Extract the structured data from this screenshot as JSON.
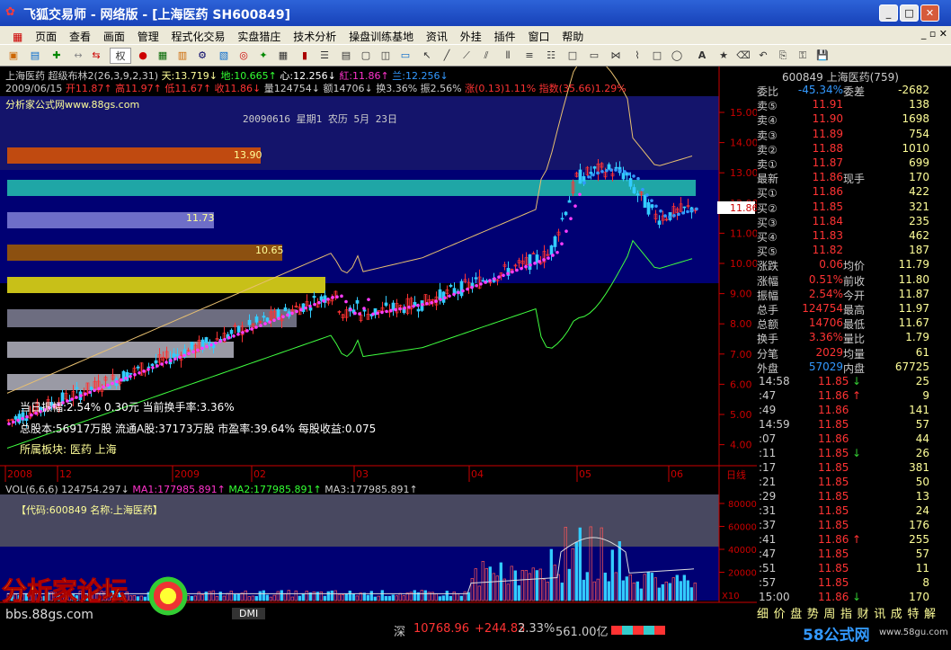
{
  "title": "飞狐交易师 - 网络版 - [上海医药 SH600849]",
  "menu": [
    "页面",
    "查看",
    "画面",
    "管理",
    "程式化交易",
    "实盘猎庄",
    "技术分析",
    "操盘训练基地",
    "资讯",
    "外挂",
    "插件",
    "窗口",
    "帮助"
  ],
  "toolbar": {
    "rights": "权"
  },
  "header": {
    "line1_name": "上海医药",
    "line1_ind": "超级布林2(26,3,9,2,31)",
    "tian": "天:13.719↓",
    "di": "地:10.665↑",
    "xin": "心:12.256↓",
    "hong": "紅:11.86↑",
    "lan": "兰:12.256↓",
    "date": "2009/06/15",
    "open": "开11.87↑",
    "high": "高11.97↑",
    "low": "低11.67↑",
    "close": "收11.86↓",
    "vol": "量124754↓",
    "amt": "额14706↓",
    "turn": "换3.36%",
    "amp": "振2.56%",
    "chg": "涨(0.13)1.11%",
    "idx": "指数(35.66)1.29%"
  },
  "chart": {
    "site": "分析家公式网www.88gs.com",
    "date_note": "20090616 星期1 农历 5月 23日",
    "zone_labels": [
      "13.90",
      "11.73",
      "10.65"
    ],
    "price_ticks": [
      "15.00",
      "14.00",
      "13.00",
      "12.00",
      "11.00",
      "10.00",
      "9.00",
      "8.00",
      "7.00",
      "6.00",
      "5.00",
      "4.00"
    ],
    "time_ticks": [
      "2008",
      "12",
      "2009",
      "02",
      "03",
      "04",
      "05",
      "06"
    ],
    "day_label": "日线",
    "cur_price": "11.86",
    "info1": "当日振幅:2.54%   0.30元    当前换手率:3.36%",
    "info2": "总股本:56917万股 流通A股:37173万股 市盈率:39.64%  每股收益:0.075",
    "info3": "所属板块: 医药 上海"
  },
  "vol": {
    "header": "VOL(6,6,6) 124754.297↓",
    "ma1": "MA1:177985.891↑",
    "ma2": "MA2:177985.891↑",
    "ma3": "MA3:177985.891↑",
    "code_label": "【代码:600849 名称:上海医药】",
    "ticks": [
      "80000",
      "60000",
      "40000",
      "20000"
    ],
    "unit": "X10",
    "tab": "DMI"
  },
  "quote": {
    "title": "600849 上海医药(759)",
    "rows": [
      {
        "l": "委比",
        "v": "-45.34%",
        "l2": "委差",
        "v2": "-2682"
      },
      {
        "l": "卖⑤",
        "v": "11.91",
        "l2": "",
        "v2": "138"
      },
      {
        "l": "卖④",
        "v": "11.90",
        "l2": "",
        "v2": "1698"
      },
      {
        "l": "卖③",
        "v": "11.89",
        "l2": "",
        "v2": "754"
      },
      {
        "l": "卖②",
        "v": "11.88",
        "l2": "",
        "v2": "1010"
      },
      {
        "l": "卖①",
        "v": "11.87",
        "l2": "",
        "v2": "699"
      },
      {
        "l": "最新",
        "v": "11.86",
        "l2": "现手",
        "v2": "170"
      },
      {
        "l": "买①",
        "v": "11.86",
        "l2": "",
        "v2": "422"
      },
      {
        "l": "买②",
        "v": "11.85",
        "l2": "",
        "v2": "321"
      },
      {
        "l": "买③",
        "v": "11.84",
        "l2": "",
        "v2": "235"
      },
      {
        "l": "买④",
        "v": "11.83",
        "l2": "",
        "v2": "462"
      },
      {
        "l": "买⑤",
        "v": "11.82",
        "l2": "",
        "v2": "187"
      },
      {
        "l": "涨跌",
        "v": "0.06",
        "l2": "均价",
        "v2": "11.79"
      },
      {
        "l": "涨幅",
        "v": "0.51%",
        "l2": "前收",
        "v2": "11.80"
      },
      {
        "l": "振幅",
        "v": "2.54%",
        "l2": "今开",
        "v2": "11.87"
      },
      {
        "l": "总手",
        "v": "124754",
        "l2": "最高",
        "v2": "11.97"
      },
      {
        "l": "总额",
        "v": "14706",
        "l2": "最低",
        "v2": "11.67"
      },
      {
        "l": "换手",
        "v": "3.36%",
        "l2": "量比",
        "v2": "1.79"
      },
      {
        "l": "分笔",
        "v": "2029",
        "l2": "均量",
        "v2": "61"
      },
      {
        "l": "外盘",
        "v": "57029",
        "l2": "内盘",
        "v2": "67725"
      }
    ],
    "ticks": [
      {
        "t": "14:58",
        "p": "11.85",
        "a": "↓",
        "v": "25"
      },
      {
        "t": ":47",
        "p": "11.86",
        "a": "↑",
        "v": "9"
      },
      {
        "t": ":49",
        "p": "11.86",
        "a": "",
        "v": "141"
      },
      {
        "t": "14:59",
        "p": "11.85",
        "a": "",
        "v": "57"
      },
      {
        "t": ":07",
        "p": "11.86",
        "a": "",
        "v": "44"
      },
      {
        "t": ":11",
        "p": "11.85",
        "a": "↓",
        "v": "26"
      },
      {
        "t": ":17",
        "p": "11.85",
        "a": "",
        "v": "381"
      },
      {
        "t": ":21",
        "p": "11.85",
        "a": "",
        "v": "50"
      },
      {
        "t": ":29",
        "p": "11.85",
        "a": "",
        "v": "13"
      },
      {
        "t": ":31",
        "p": "11.85",
        "a": "",
        "v": "24"
      },
      {
        "t": ":37",
        "p": "11.85",
        "a": "",
        "v": "176"
      },
      {
        "t": ":41",
        "p": "11.86",
        "a": "↑",
        "v": "255"
      },
      {
        "t": ":47",
        "p": "11.85",
        "a": "",
        "v": "57"
      },
      {
        "t": ":51",
        "p": "11.85",
        "a": "",
        "v": "11"
      },
      {
        "t": ":57",
        "p": "11.85",
        "a": "",
        "v": "8"
      },
      {
        "t": "15:00",
        "p": "11.86",
        "a": "↓",
        "v": "170"
      }
    ],
    "tabs": [
      "细",
      "价",
      "盘",
      "势",
      "周",
      "指",
      "财",
      "讯",
      "成",
      "特",
      "解"
    ]
  },
  "status": {
    "market": "深",
    "index": "10768.96",
    "change": "+244.83",
    "pct": "2.33%",
    "amount": "561.00亿"
  },
  "watermark": {
    "brand": "分析家论坛",
    "url": "bbs.88gs.com",
    "brand2": "58公式网",
    "url2": "www.58gu.com"
  }
}
